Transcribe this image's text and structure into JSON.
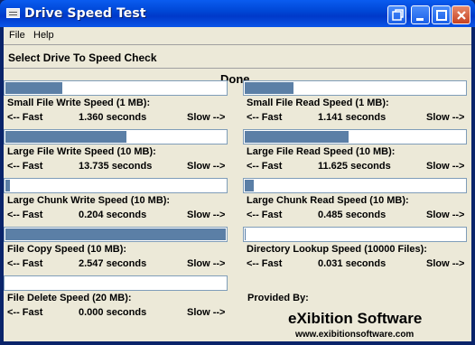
{
  "window": {
    "title": "Drive Speed Test"
  },
  "menu": [
    "File",
    "Help"
  ],
  "prompt": "Select Drive To Speed Check",
  "status": "Done",
  "legend": {
    "fast": "<-- Fast",
    "slow": "Slow -->"
  },
  "tests": [
    {
      "label": "Small File Write Speed (1 MB):",
      "value": "1.360 seconds",
      "fill": 0.26
    },
    {
      "label": "Small File Read Speed (1 MB):",
      "value": "1.141 seconds",
      "fill": 0.22
    },
    {
      "label": "Large File Write Speed (10 MB):",
      "value": "13.735 seconds",
      "fill": 0.55
    },
    {
      "label": "Large File Read Speed (10 MB):",
      "value": "11.625 seconds",
      "fill": 0.47
    },
    {
      "label": "Large Chunk Write Speed (10 MB):",
      "value": "0.204 seconds",
      "fill": 0.02
    },
    {
      "label": "Large Chunk Read Speed (10 MB):",
      "value": "0.485 seconds",
      "fill": 0.04
    },
    {
      "label": "File Copy Speed (10 MB):",
      "value": "2.547 seconds",
      "fill": 1.0
    },
    {
      "label": "Directory Lookup Speed (10000 Files):",
      "value": "0.031 seconds",
      "fill": 0.005
    },
    {
      "label": "File Delete Speed (20 MB):",
      "value": "0.000 seconds",
      "fill": 0.0
    }
  ],
  "footer": {
    "provided_by": "Provided By:",
    "company": "eXibition Software",
    "url": "www.exibitionsoftware.com"
  }
}
